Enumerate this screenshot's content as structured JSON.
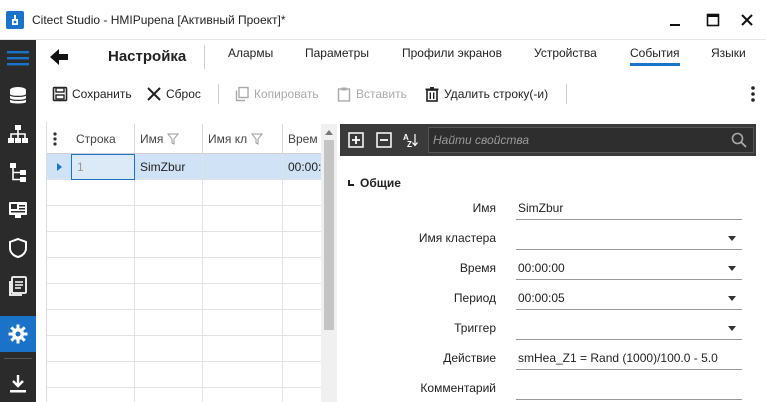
{
  "window": {
    "title": "Citect Studio - HMIPupena [Активный Проект]*",
    "icons": {
      "app": "citect-app-icon",
      "minimize": "minimize-icon",
      "maximize": "maximize-icon",
      "close": "close-icon"
    }
  },
  "sidebar": {
    "items": [
      {
        "name": "menu",
        "icon": "hamburger-icon",
        "active": false
      },
      {
        "name": "database",
        "icon": "database-icon",
        "active": false
      },
      {
        "name": "network",
        "icon": "network-icon",
        "active": false
      },
      {
        "name": "hierarchy",
        "icon": "hierarchy-icon",
        "active": false
      },
      {
        "name": "display",
        "icon": "display-icon",
        "active": false
      },
      {
        "name": "security",
        "icon": "shield-icon",
        "active": false
      },
      {
        "name": "documents",
        "icon": "documents-icon",
        "active": false
      },
      {
        "name": "settings",
        "icon": "gear-icon",
        "active": true
      },
      {
        "name": "download",
        "icon": "download-icon",
        "active": false
      }
    ],
    "accent": "#1a73c8",
    "background": "#2b2b2b"
  },
  "navbar": {
    "title": "Настройка",
    "tabs": [
      {
        "label": "Алармы",
        "active": false
      },
      {
        "label": "Параметры",
        "active": false
      },
      {
        "label": "Профили экранов",
        "active": false
      },
      {
        "label": "Устройства",
        "active": false
      },
      {
        "label": "События",
        "active": true
      },
      {
        "label": "Языки",
        "active": false
      }
    ]
  },
  "toolbar": {
    "save_label": "Сохранить",
    "reset_label": "Сброс",
    "copy_label": "Копировать",
    "paste_label": "Вставить",
    "delete_row_label": "Удалить строку(-и)",
    "copy_enabled": false,
    "paste_enabled": false
  },
  "grid": {
    "columns": [
      "Строка",
      "Имя",
      "Имя кл",
      "Врем"
    ],
    "rows": [
      {
        "row": "1",
        "name": "SimZbur",
        "cluster": "",
        "time": "00:00:"
      }
    ],
    "selected_row": 0
  },
  "properties": {
    "search_placeholder": "Найти свойства",
    "group": "Общие",
    "fields": [
      {
        "label": "Имя",
        "value": "SimZbur",
        "dropdown": false
      },
      {
        "label": "Имя кластера",
        "value": "",
        "dropdown": true
      },
      {
        "label": "Время",
        "value": "00:00:00",
        "dropdown": true
      },
      {
        "label": "Период",
        "value": "00:00:05",
        "dropdown": true
      },
      {
        "label": "Триггер",
        "value": "",
        "dropdown": true
      },
      {
        "label": "Действие",
        "value": "smHea_Z1 = Rand (1000)/100.0 - 5.0",
        "dropdown": false
      },
      {
        "label": "Комментарий",
        "value": "",
        "dropdown": false
      }
    ]
  }
}
